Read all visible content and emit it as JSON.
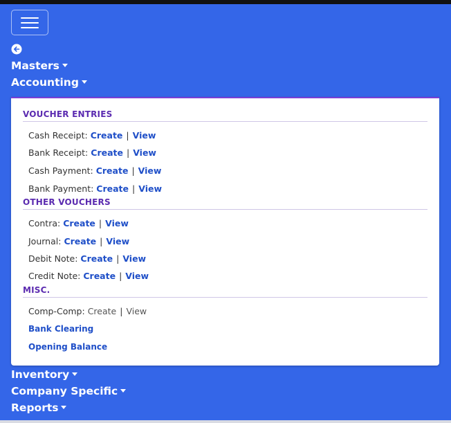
{
  "colors": {
    "background": "#3466e8",
    "section_title": "#5b2bb0",
    "link": "#1f4fc8",
    "dropdown_border": "#7a3fd6"
  },
  "header": {
    "menu_icon": "hamburger-icon",
    "back_icon": "back-arrow-icon"
  },
  "nav": {
    "masters": "Masters",
    "accounting": "Accounting",
    "inventory": "Inventory",
    "company_specific": "Company Specific",
    "reports": "Reports"
  },
  "accounting_menu": {
    "voucher_entries": {
      "title": "VOUCHER ENTRIES",
      "items": [
        {
          "label": "Cash Receipt:",
          "create": "Create",
          "view": "View"
        },
        {
          "label": "Bank Receipt:",
          "create": "Create",
          "view": "View"
        },
        {
          "label": "Cash Payment:",
          "create": "Create",
          "view": "View"
        },
        {
          "label": "Bank Payment:",
          "create": "Create",
          "view": "View"
        }
      ]
    },
    "other_vouchers": {
      "title": "OTHER VOUCHERS",
      "items": [
        {
          "label": "Contra:",
          "create": "Create",
          "view": "View"
        },
        {
          "label": "Journal:",
          "create": "Create",
          "view": "View"
        },
        {
          "label": "Debit Note:",
          "create": "Create",
          "view": "View"
        },
        {
          "label": "Credit Note:",
          "create": "Create",
          "view": "View"
        }
      ]
    },
    "misc": {
      "title": "MISC.",
      "comp_comp": {
        "label": "Comp-Comp:",
        "create": "Create",
        "view": "View"
      },
      "bank_clearing": "Bank Clearing",
      "opening_balance": "Opening Balance"
    }
  },
  "separator": "|"
}
